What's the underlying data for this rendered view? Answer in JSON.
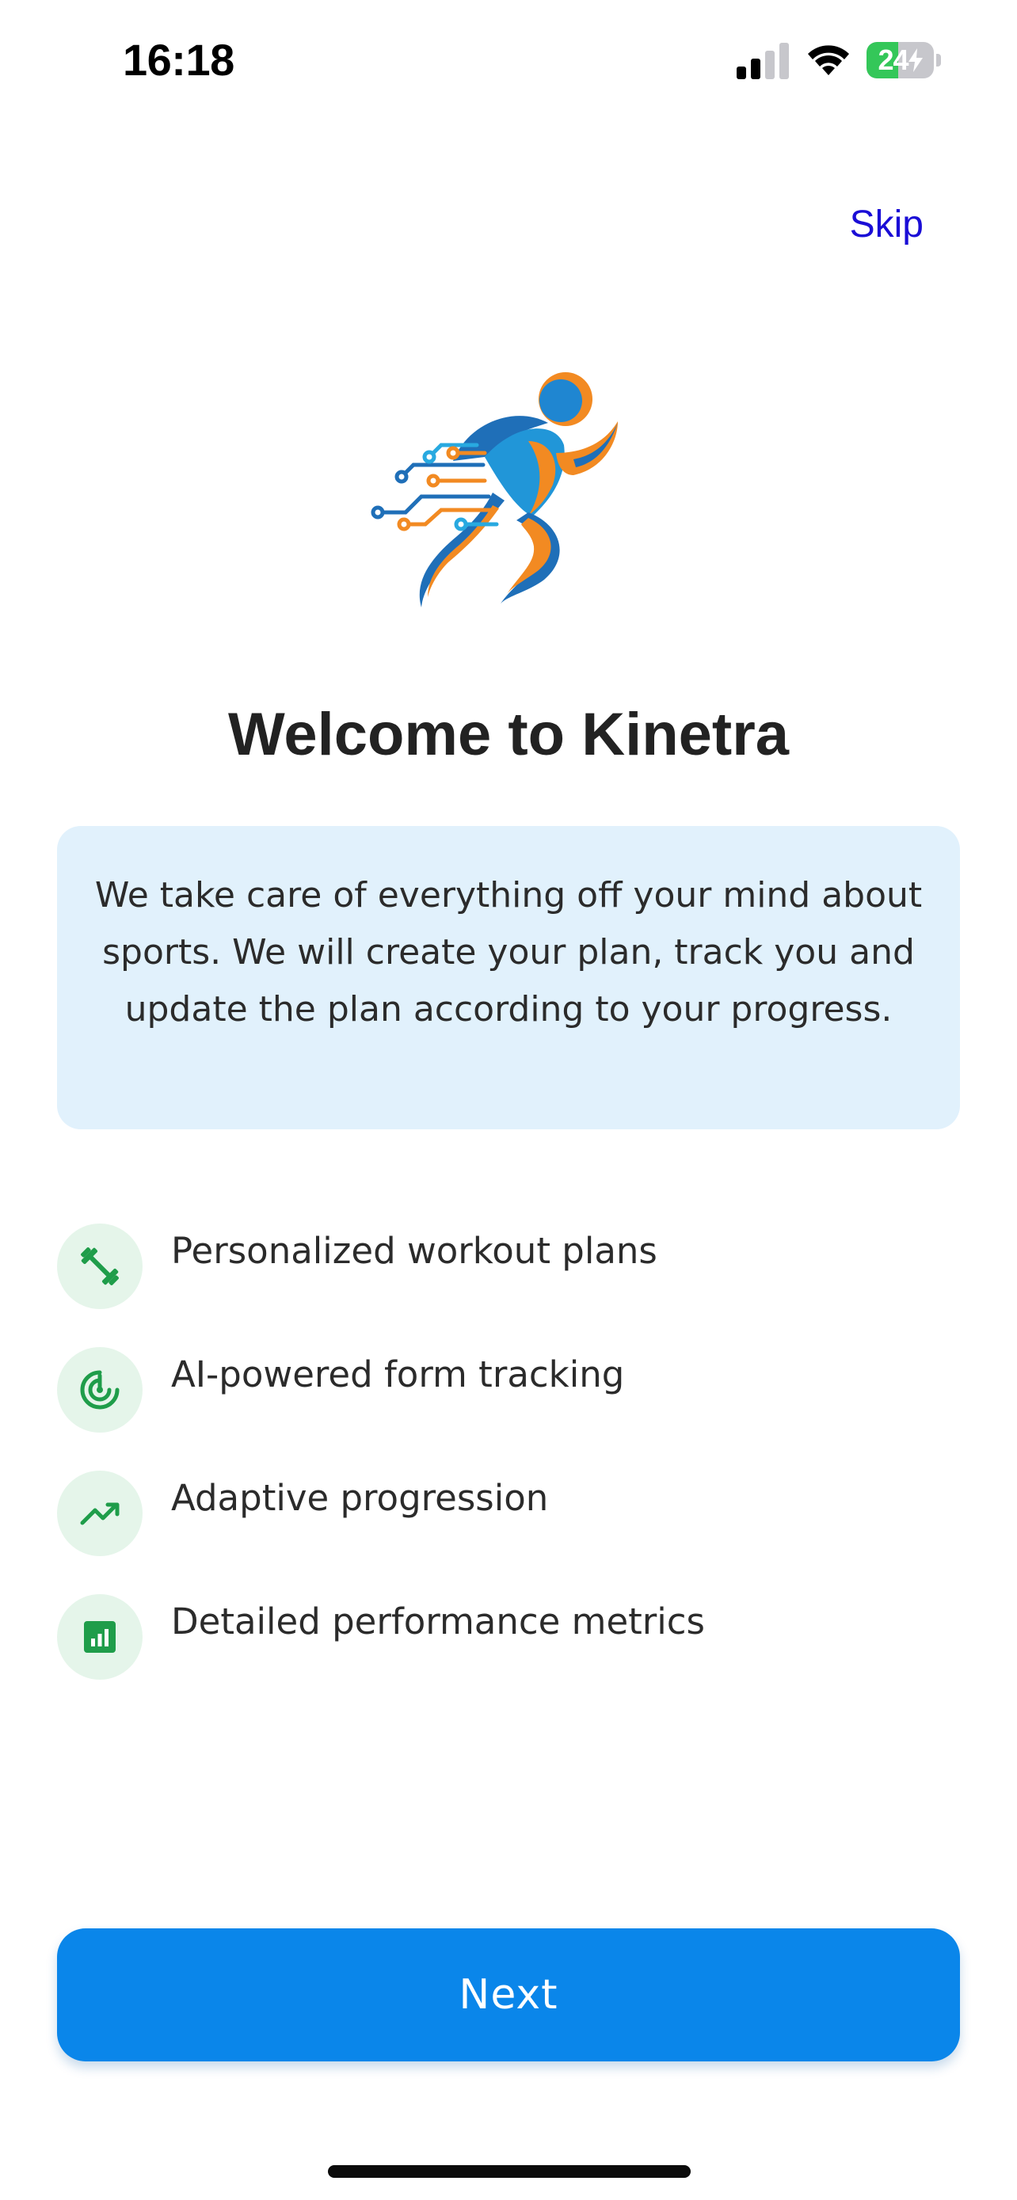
{
  "status_bar": {
    "time": "16:18",
    "battery_level": "24",
    "battery_fraction": 0.24,
    "battery_color": "#34c759",
    "signal_bars_active": 2,
    "signal_bars_total": 4,
    "icons": [
      "signal-icon",
      "wifi-icon",
      "battery-icon"
    ]
  },
  "header": {
    "skip_label": "Skip",
    "skip_color": "#1a0dd6"
  },
  "logo": {
    "icon": "running-athlete-circuit-logo",
    "colors": [
      "#1f6fb8",
      "#f28a22",
      "#28a9e0"
    ]
  },
  "welcome": {
    "title": "Welcome to Kinetra",
    "intro": "We take care of everything off your mind about sports. We will create your plan, track you and update the plan according to your progress.",
    "intro_background": "#e1f1fc"
  },
  "features": [
    {
      "label": "Personalized workout plans",
      "icon": "dumbbell-icon"
    },
    {
      "label": "AI-powered form tracking",
      "icon": "target-icon"
    },
    {
      "label": "Adaptive progression",
      "icon": "trending-up-icon"
    },
    {
      "label": "Detailed performance metrics",
      "icon": "bar-chart-icon"
    }
  ],
  "feature_icon_color": "#1f9d4a",
  "feature_icon_background": "#e5f5ea",
  "footer": {
    "next_label": "Next",
    "next_color": "#0a86ea"
  }
}
